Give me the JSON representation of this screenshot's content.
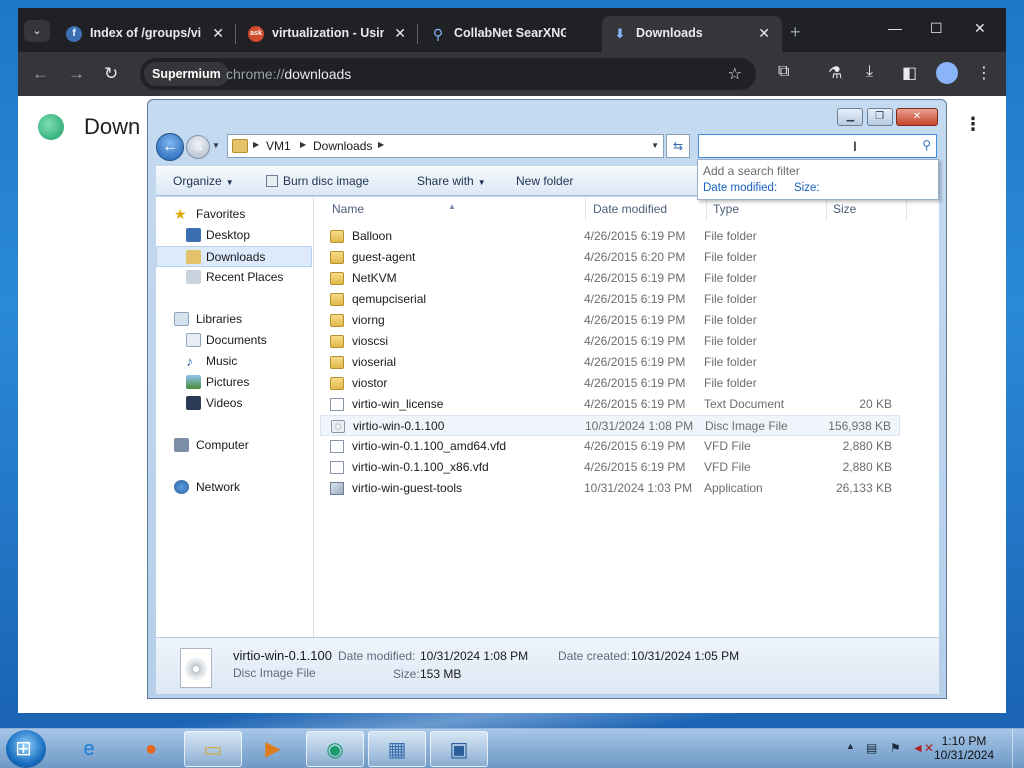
{
  "browser": {
    "tabs": [
      {
        "label": "Index of /groups/virt",
        "favicon": "fedora-icon",
        "color": "#3c6eb4"
      },
      {
        "label": "virtualization - Using",
        "favicon": "ask-icon",
        "color": "#d04a2e"
      },
      {
        "label": "CollabNet SearXNG",
        "favicon": "search-icon",
        "color": "#4285f4"
      },
      {
        "label": "Downloads",
        "favicon": "download-icon",
        "color": "#8ab4f8"
      }
    ],
    "omnibox_chip": "Supermium",
    "url_scheme": "chrome://",
    "url_path": "downloads",
    "page_title": "Down"
  },
  "explorer": {
    "address": [
      "VM1",
      "Downloads"
    ],
    "toolbar": {
      "organize": "Organize",
      "burn": "Burn disc image",
      "share": "Share with",
      "new_folder": "New folder"
    },
    "search": {
      "hint": "Add a search filter",
      "filter_date": "Date modified:",
      "filter_size": "Size:"
    },
    "nav": {
      "favorites": "Favorites",
      "desktop": "Desktop",
      "downloads": "Downloads",
      "recent": "Recent Places",
      "libraries": "Libraries",
      "documents": "Documents",
      "music": "Music",
      "pictures": "Pictures",
      "videos": "Videos",
      "computer": "Computer",
      "network": "Network"
    },
    "columns": {
      "name": "Name",
      "date": "Date modified",
      "type": "Type",
      "size": "Size"
    },
    "files": [
      {
        "name": "Balloon",
        "date": "4/26/2015 6:19 PM",
        "type": "File folder",
        "size": "",
        "icon": "folder"
      },
      {
        "name": "guest-agent",
        "date": "4/26/2015 6:20 PM",
        "type": "File folder",
        "size": "",
        "icon": "folder"
      },
      {
        "name": "NetKVM",
        "date": "4/26/2015 6:19 PM",
        "type": "File folder",
        "size": "",
        "icon": "folder"
      },
      {
        "name": "qemupciserial",
        "date": "4/26/2015 6:19 PM",
        "type": "File folder",
        "size": "",
        "icon": "folder"
      },
      {
        "name": "viorng",
        "date": "4/26/2015 6:19 PM",
        "type": "File folder",
        "size": "",
        "icon": "folder"
      },
      {
        "name": "vioscsi",
        "date": "4/26/2015 6:19 PM",
        "type": "File folder",
        "size": "",
        "icon": "folder"
      },
      {
        "name": "vioserial",
        "date": "4/26/2015 6:19 PM",
        "type": "File folder",
        "size": "",
        "icon": "folder"
      },
      {
        "name": "viostor",
        "date": "4/26/2015 6:19 PM",
        "type": "File folder",
        "size": "",
        "icon": "folder"
      },
      {
        "name": "virtio-win_license",
        "date": "4/26/2015 6:19 PM",
        "type": "Text Document",
        "size": "20 KB",
        "icon": "doc"
      },
      {
        "name": "virtio-win-0.1.100",
        "date": "10/31/2024 1:08 PM",
        "type": "Disc Image File",
        "size": "156,938 KB",
        "icon": "disc"
      },
      {
        "name": "virtio-win-0.1.100_amd64.vfd",
        "date": "4/26/2015 6:19 PM",
        "type": "VFD File",
        "size": "2,880 KB",
        "icon": "doc"
      },
      {
        "name": "virtio-win-0.1.100_x86.vfd",
        "date": "4/26/2015 6:19 PM",
        "type": "VFD File",
        "size": "2,880 KB",
        "icon": "doc"
      },
      {
        "name": "virtio-win-guest-tools",
        "date": "10/31/2024 1:03 PM",
        "type": "Application",
        "size": "26,133 KB",
        "icon": "app"
      }
    ],
    "details": {
      "name": "virtio-win-0.1.100",
      "kind": "Disc Image File",
      "modified_label": "Date modified:",
      "modified": "10/31/2024 1:08 PM",
      "created_label": "Date created:",
      "created": "10/31/2024 1:05 PM",
      "size_label": "Size:",
      "size": "153 MB"
    }
  },
  "taskbar": {
    "time": "1:10 PM",
    "date": "10/31/2024"
  }
}
